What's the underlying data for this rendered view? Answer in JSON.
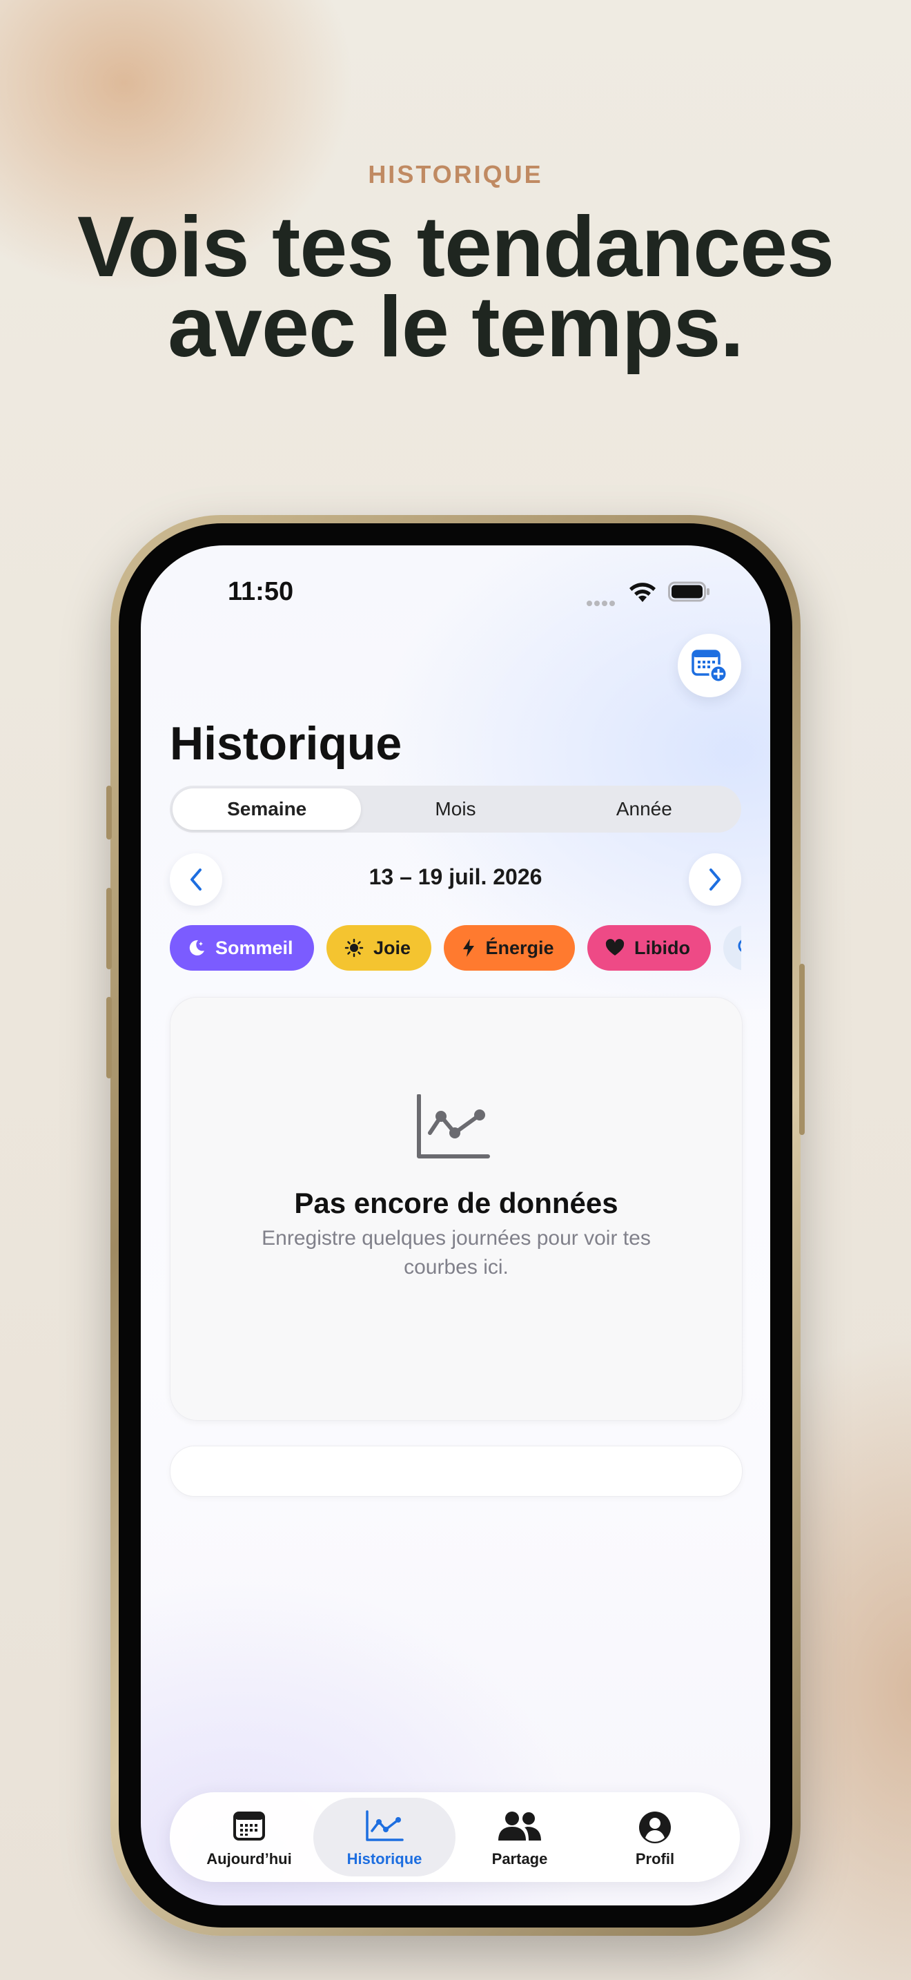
{
  "promo": {
    "eyebrow": "HISTORIQUE",
    "headline_line1": "Vois tes tendances",
    "headline_line2": "avec le temps."
  },
  "status_bar": {
    "time": "11:50"
  },
  "header": {
    "title": "Historique",
    "calendar_add_icon": "calendar-plus-icon"
  },
  "period_selector": {
    "options": [
      "Semaine",
      "Mois",
      "Année"
    ],
    "selected": "Semaine"
  },
  "date_nav": {
    "range": "13 – 19 juil. 2026",
    "prev_icon": "chevron-left-icon",
    "next_icon": "chevron-right-icon"
  },
  "filters": [
    {
      "label": "Sommeil",
      "icon": "moon-icon",
      "color": "#7b5cff",
      "text_color": "#ffffff"
    },
    {
      "label": "Joie",
      "icon": "sun-icon",
      "color": "#f4c430",
      "text_color": "#1a1a1a"
    },
    {
      "label": "Énergie",
      "icon": "bolt-icon",
      "color": "#ff7a2f",
      "text_color": "#1a1a1a"
    },
    {
      "label": "Libido",
      "icon": "heart-icon",
      "color": "#ee4a86",
      "text_color": "#1a1a1a"
    }
  ],
  "empty_state": {
    "icon": "line-chart-icon",
    "title": "Pas encore de données",
    "subtitle": "Enregistre quelques journées pour voir tes courbes ici."
  },
  "tabbar": {
    "items": [
      {
        "label": "Aujourd’hui",
        "icon": "calendar-icon"
      },
      {
        "label": "Historique",
        "icon": "chart-icon"
      },
      {
        "label": "Partage",
        "icon": "people-icon"
      },
      {
        "label": "Profil",
        "icon": "person-circle-icon"
      }
    ],
    "active": "Historique",
    "accent_color": "#1d6ee0"
  }
}
